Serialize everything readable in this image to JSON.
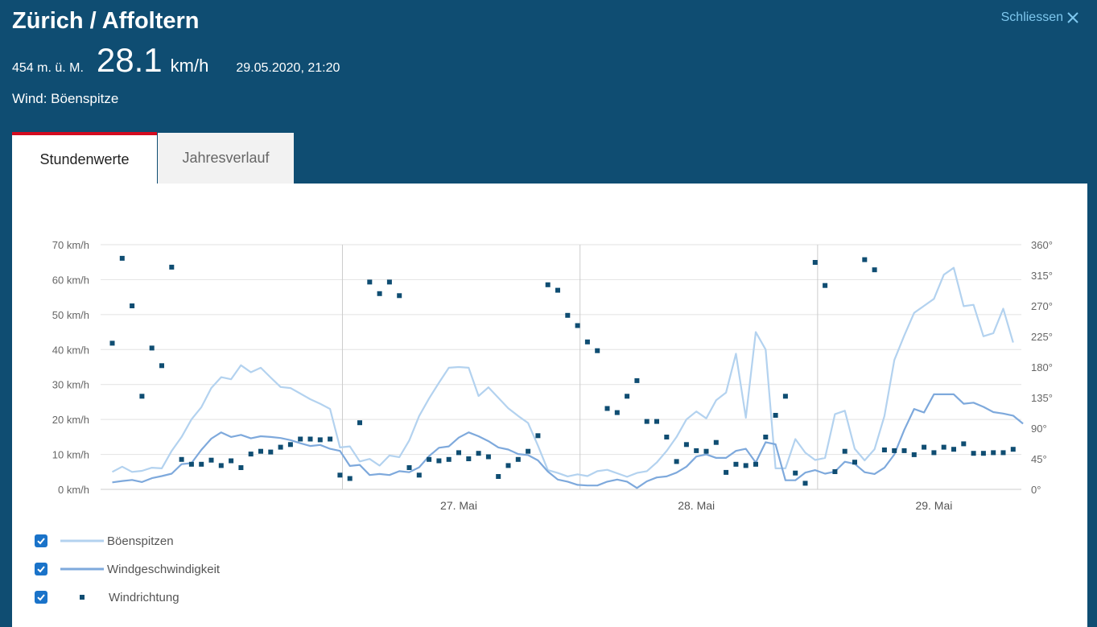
{
  "header": {
    "title": "Zürich / Affoltern",
    "close_label": "Schliessen",
    "altitude": "454 m. ü. M.",
    "value": "28.1",
    "unit": "km/h",
    "timestamp": "29.05.2020, 21:20",
    "parameter": "Wind: Böenspitze"
  },
  "tabs": [
    {
      "label": "Stundenwerte",
      "active": true
    },
    {
      "label": "Jahresverlauf",
      "active": false
    }
  ],
  "legend": [
    {
      "label": "Böenspitzen",
      "checked": true
    },
    {
      "label": "Windgeschwindigkeit",
      "checked": true
    },
    {
      "label": "Windrichtung",
      "checked": true
    }
  ],
  "colors": {
    "header_bg": "#0f4d72",
    "accent_red": "#d40b1f",
    "link": "#7ec7ee",
    "gusts": "#b3d2ef",
    "speed": "#7ea9dc",
    "direction": "#0f4d72",
    "checkbox": "#1a73c9"
  },
  "chart_data": {
    "type": "line",
    "x_tick_labels": [
      "27. Mai",
      "28. Mai",
      "29. Mai"
    ],
    "y_left": {
      "ticks": [
        "0 km/h",
        "10 km/h",
        "20 km/h",
        "30 km/h",
        "40 km/h",
        "50 km/h",
        "60 km/h",
        "70 km/h"
      ],
      "range": [
        0,
        70
      ]
    },
    "y_right": {
      "ticks": [
        "0°",
        "45°",
        "90°",
        "135°",
        "180°",
        "225°",
        "270°",
        "315°",
        "360°"
      ],
      "range": [
        0,
        360
      ]
    },
    "grid": true,
    "legend_position": "bottom-left",
    "series": [
      {
        "name": "Böenspitzen",
        "kind": "line",
        "values": [
          5,
          6.5,
          5,
          5.3,
          6.2,
          6,
          11,
          15,
          20,
          23.5,
          29,
          32.1,
          31.5,
          35.5,
          33.5,
          34.8,
          32,
          29.3,
          29,
          27.4,
          25.8,
          24.5,
          23,
          12,
          12.3,
          8,
          8.7,
          6.8,
          9.7,
          9.2,
          14,
          21,
          26,
          30.5,
          34.8,
          35,
          34.8,
          26.7,
          29.2,
          26.2,
          23.2,
          21,
          19,
          12.5,
          5.5,
          4.7,
          3.7,
          4.3,
          3.8,
          5.2,
          5.6,
          4.6,
          3.6,
          4.7,
          5.2,
          7.7,
          11,
          15,
          20,
          22.3,
          20.3,
          25.5,
          27.7,
          38.8,
          20.5,
          45,
          40,
          6,
          6,
          14.4,
          10.5,
          8.4,
          9,
          21.5,
          22.5,
          11.6,
          8.3,
          11.5,
          21,
          37,
          44,
          50.5,
          52.5,
          54.5,
          61.4,
          63.4,
          52.4,
          52.8,
          43.8,
          44.7,
          51.7,
          42
        ]
      },
      {
        "name": "Windgeschwindigkeit",
        "kind": "line",
        "values": [
          2,
          2.4,
          2.7,
          2.1,
          3.2,
          3.8,
          4.5,
          7.2,
          7.5,
          11.3,
          14.5,
          16.3,
          15,
          15.6,
          14.6,
          15.2,
          15,
          14.7,
          14.1,
          13.2,
          12.4,
          12.7,
          11.6,
          11,
          6.7,
          7,
          4.1,
          4.4,
          4.1,
          5.2,
          4.9,
          6.3,
          9.5,
          11.9,
          12.3,
          14.8,
          16.3,
          15.2,
          13.8,
          12,
          11.4,
          10.1,
          9.8,
          8.3,
          5.1,
          2.8,
          2.2,
          1.3,
          1.1,
          1.1,
          2.2,
          2.8,
          2.2,
          0.4,
          2.3,
          3.4,
          3.7,
          4.8,
          6.5,
          9.4,
          10,
          9,
          9,
          11,
          11.6,
          7.7,
          13.5,
          12.9,
          2.6,
          2.6,
          4.8,
          5.5,
          4.5,
          5.1,
          7.9,
          7.3,
          4.9,
          4.4,
          6.2,
          10,
          17,
          23,
          22,
          27.2,
          27.2,
          27.2,
          24.5,
          24.8,
          23.6,
          22.1,
          21.7,
          21.1,
          18.8
        ]
      },
      {
        "name": "Windrichtung",
        "kind": "scatter",
        "axis": "right",
        "points": [
          [
            0,
            215
          ],
          [
            1,
            340
          ],
          [
            2,
            270
          ],
          [
            3,
            137
          ],
          [
            4,
            208
          ],
          [
            5,
            182
          ],
          [
            6,
            327
          ],
          [
            7,
            44
          ],
          [
            8,
            37
          ],
          [
            9,
            37
          ],
          [
            10,
            43
          ],
          [
            11,
            35
          ],
          [
            12,
            42
          ],
          [
            13,
            32
          ],
          [
            14,
            52
          ],
          [
            15,
            56
          ],
          [
            16,
            55
          ],
          [
            17,
            62
          ],
          [
            18,
            66
          ],
          [
            19,
            74
          ],
          [
            20,
            74
          ],
          [
            21,
            73
          ],
          [
            22,
            74
          ],
          [
            23,
            21
          ],
          [
            24,
            16
          ],
          [
            25,
            98
          ],
          [
            26,
            305
          ],
          [
            27,
            288
          ],
          [
            28,
            305
          ],
          [
            29,
            285
          ],
          [
            30,
            32
          ],
          [
            31,
            21
          ],
          [
            32,
            44
          ],
          [
            33,
            42
          ],
          [
            34,
            44
          ],
          [
            35,
            54
          ],
          [
            36,
            45
          ],
          [
            37,
            53
          ],
          [
            38,
            48
          ],
          [
            39,
            19
          ],
          [
            40,
            35
          ],
          [
            41,
            44
          ],
          [
            42,
            56
          ],
          [
            43,
            79
          ],
          [
            44,
            301
          ],
          [
            45,
            293
          ],
          [
            46,
            256
          ],
          [
            47,
            241
          ],
          [
            48,
            217
          ],
          [
            49,
            204
          ],
          [
            50,
            119
          ],
          [
            51,
            113
          ],
          [
            52,
            137
          ],
          [
            53,
            160
          ],
          [
            54,
            100
          ],
          [
            55,
            100
          ],
          [
            56,
            77
          ],
          [
            57,
            41
          ],
          [
            58,
            66
          ],
          [
            59,
            57
          ],
          [
            60,
            56
          ],
          [
            61,
            69
          ],
          [
            62,
            25
          ],
          [
            63,
            37
          ],
          [
            64,
            35
          ],
          [
            65,
            37
          ],
          [
            66,
            77
          ],
          [
            67,
            109
          ],
          [
            68,
            137
          ],
          [
            69,
            24
          ],
          [
            70,
            9
          ],
          [
            71,
            334
          ],
          [
            72,
            300
          ],
          [
            73,
            26
          ],
          [
            74,
            56
          ],
          [
            75,
            40
          ],
          [
            76,
            338
          ],
          [
            77,
            323
          ],
          [
            78,
            58
          ],
          [
            79,
            57
          ],
          [
            80,
            57
          ],
          [
            81,
            51
          ],
          [
            82,
            62
          ],
          [
            83,
            54
          ],
          [
            84,
            62
          ],
          [
            85,
            59
          ],
          [
            86,
            67
          ],
          [
            87,
            53
          ],
          [
            88,
            53
          ],
          [
            89,
            54
          ],
          [
            90,
            54
          ],
          [
            91,
            59
          ]
        ]
      }
    ]
  }
}
